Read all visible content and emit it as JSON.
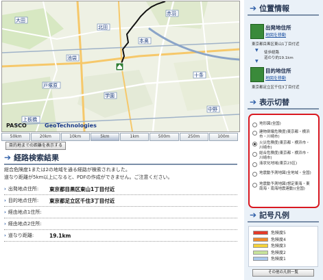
{
  "map": {
    "logo_left": "PASCO",
    "logo_right": "GeoTechnologies",
    "station_labels": [
      "大田",
      "戸塚原",
      "上板橋",
      "北田",
      "本奥",
      "学園",
      "赤羽",
      "十条",
      "池袋",
      "中野"
    ]
  },
  "scale": {
    "options": [
      "50km",
      "20km",
      "10km",
      "5km",
      "1km",
      "500m",
      "250m",
      "100m"
    ],
    "active_index": 3,
    "fit_button": "目的地までの距離を表示する"
  },
  "result": {
    "title": "経路検索結果",
    "desc1": "総合危険度1または2の地域を通る経路が検索されました。",
    "desc2": "道なり距離が5km以上になると、PDFの作成ができません。ご注意ください。",
    "rows": [
      {
        "label": "出発地点住所:",
        "value": "東京都目黒区東山1丁目付近"
      },
      {
        "label": "目的地点住所:",
        "value": "東京都足立区千住3丁目付近"
      },
      {
        "label": "経由地点1住所:",
        "value": ""
      },
      {
        "label": "経由地点2住所:",
        "value": ""
      },
      {
        "label": "道なり距離:",
        "value": "19.1km"
      }
    ]
  },
  "side": {
    "position_title": "位置情報",
    "start_title": "出発地住所",
    "start_link": "地図を移動",
    "start_addr": "東京都目黒区東山1丁目付近",
    "route_label": "徒歩経路",
    "route_dist": "道のり約19.1km",
    "dest_title": "目的地住所",
    "dest_link": "地図を移動",
    "dest_addr": "東京都足立区千住3丁目付近",
    "display_title": "表示切替",
    "options": [
      "地形図(全国)",
      "建物倒壊危険度(東京都・横浜市・川崎市)",
      "火災危険度(東京都・横浜市・川崎市)",
      "総合危険度(東京都・横浜市・川崎市)",
      "液状化地域(東京23区)",
      "地震動予測地図(全地域・全国)",
      "地震動予測地図(想定東海・東南海・南海地震連動)(全国)"
    ],
    "selected_option": 2,
    "legend_title": "記号凡例",
    "legend_items": [
      {
        "label": "危険度5",
        "color": "#e33a2a"
      },
      {
        "label": "危険度4",
        "color": "#f08a2a"
      },
      {
        "label": "危険度3",
        "color": "#f4d23a"
      },
      {
        "label": "危険度2",
        "color": "#c7e39a"
      },
      {
        "label": "危険度1",
        "color": "#a9c8ec"
      }
    ],
    "legend_button": "その他の凡例一覧"
  }
}
